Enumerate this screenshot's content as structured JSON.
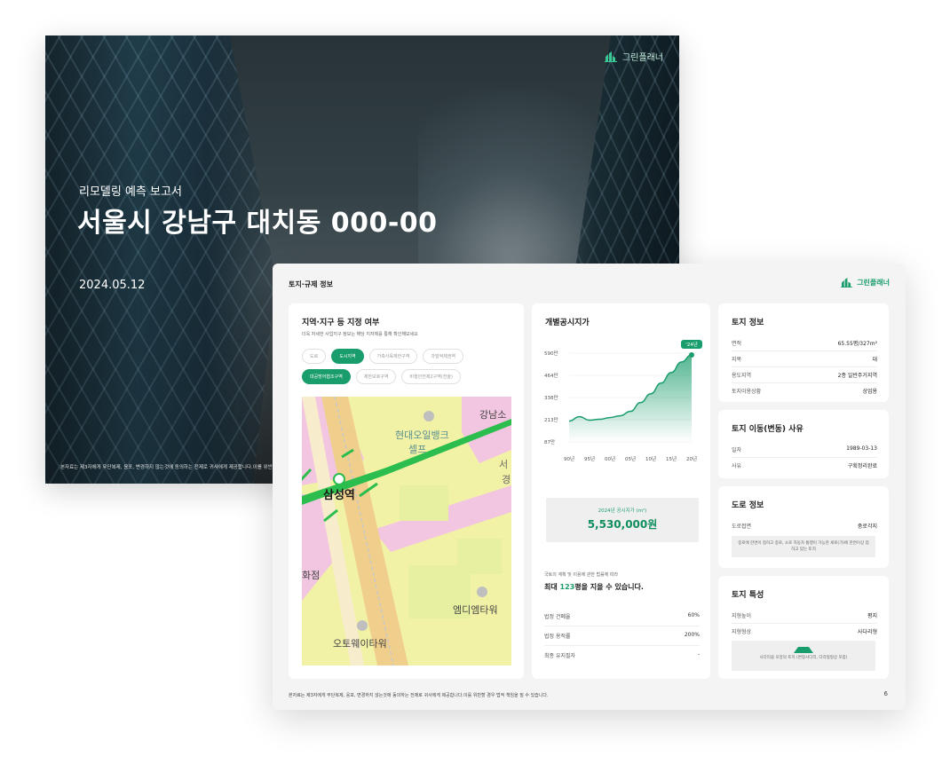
{
  "cover": {
    "brand": "그린플래너",
    "subtitle": "리모델링 예측 보고서",
    "title": "서울시 강남구 대치동 000-00",
    "date": "2024.05.12",
    "notice": "본자료는 제3자에게 무단복제, 응포, 변경하지 않는것에 동의하는 전제로 귀사에게 제공합니다.이를 위반"
  },
  "report": {
    "header": "토지·규제 정보",
    "brand": "그린플래너",
    "footer": "본자료는 제3자에게 무단복제, 응포, 변경하지 않는것에 동의하는 전제로 귀사에게 제공합니다.이를 위반할 경우 법적 책임을 질 수 있습니다.",
    "page": "6",
    "accent": "#1a9d6c"
  },
  "zoning": {
    "title": "지역·지구 등 지정 여부",
    "desc": "더욱 자세한 사업지구 정보는 해당 지자체를 통해 확인해보세요",
    "chips_row1": [
      {
        "label": "도로",
        "on": false
      },
      {
        "label": "도시지역",
        "on": true
      },
      {
        "label": "가축사육제한구역",
        "on": false
      },
      {
        "label": "과밀억제권역",
        "on": false
      }
    ],
    "chips_row2": [
      {
        "label": "대공방어협조구역",
        "on": true
      },
      {
        "label": "제한보호구역",
        "on": false
      },
      {
        "label": "비행안전제2구역(전술)",
        "on": false
      }
    ],
    "map_labels": {
      "station": "삼성역",
      "bank": "현대오일뱅크",
      "self": "셀프",
      "gangnam": "강남소",
      "seo": "서",
      "gyeong": "경",
      "mdm": "엠디엠타워",
      "oto": "오토웨이타워",
      "hwajeom": "화점"
    }
  },
  "price": {
    "title": "개별공시지가",
    "box_label": "2024년 공시지가 (m²)",
    "box_value": "5,530,000원",
    "law": "국토의 계획 및 이용에 관한 법률에 따라",
    "max_pre": "최대 ",
    "max_num": "123",
    "max_post": "평을 지을 수 있습니다.",
    "ratios": [
      {
        "k": "법정 건폐율",
        "v": "60%"
      },
      {
        "k": "법정 용적률",
        "v": "200%"
      },
      {
        "k": "최종 유지필자",
        "v": "-"
      }
    ]
  },
  "chart_data": {
    "type": "area",
    "title": "개별공시지가",
    "categories": [
      "90년",
      "95년",
      "00년",
      "05년",
      "10년",
      "15년",
      "20년"
    ],
    "y_ticks": [
      "87만",
      "213만",
      "338만",
      "464만",
      "590만"
    ],
    "ylim": [
      87,
      590
    ],
    "series": [
      {
        "x": [
          0,
          0.5,
          1,
          1.5,
          2,
          2.5,
          3,
          3.5,
          4,
          4.5,
          5,
          5.5,
          6
        ],
        "values": [
          205,
          230,
          210,
          215,
          225,
          235,
          260,
          310,
          360,
          420,
          480,
          540,
          580
        ]
      }
    ],
    "latest_label": "'24년",
    "grid": true,
    "colors": {
      "line": "#1a9d6c"
    }
  },
  "land_info": {
    "title": "토지 정보",
    "rows": [
      {
        "k": "면적",
        "v": "65.55평/327m²"
      },
      {
        "k": "지목",
        "v": "대"
      },
      {
        "k": "용도지역",
        "v": "2종 일반주거지역"
      },
      {
        "k": "토지이용상황",
        "v": "상업용"
      }
    ]
  },
  "land_history": {
    "title": "토지 이동(변동) 사유",
    "rows": [
      {
        "k": "일자",
        "v": "1989-03-13"
      },
      {
        "k": "사유",
        "v": "구획정리완료"
      }
    ]
  },
  "road_info": {
    "title": "도로 정보",
    "rows": [
      {
        "k": "도로접면",
        "v": "중로각지"
      }
    ],
    "note": "중로에 한면이 접하고 중로, 소로 자동차 통행이 가능한 세로(가)에 한면이상 접하고 있는 토지"
  },
  "land_char": {
    "title": "토지 특성",
    "rows": [
      {
        "k": "지형높이",
        "v": "평지"
      },
      {
        "k": "지형형상",
        "v": "사다리형"
      }
    ],
    "note": "사다리꼴 모양의 토지 (변형사다리, 다각형형상 포함)"
  }
}
